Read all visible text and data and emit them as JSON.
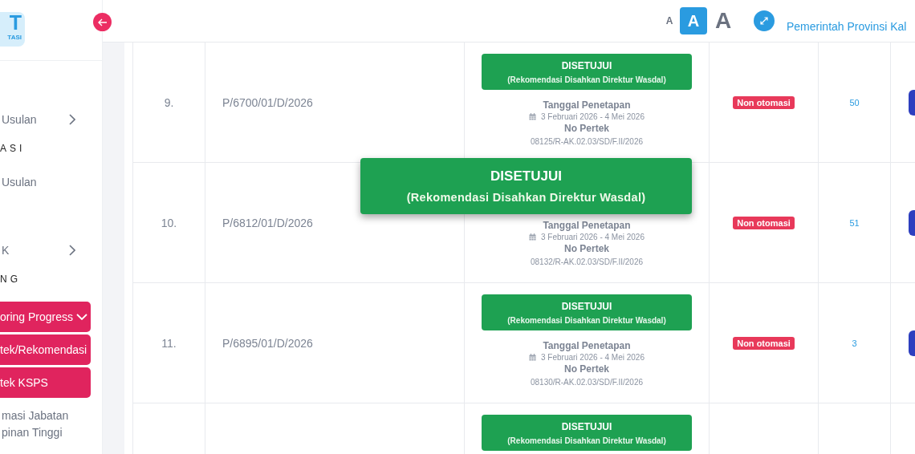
{
  "sidebar": {
    "logo": {
      "mark": "T",
      "caption": "TASI"
    },
    "items": [
      {
        "kind": "submenu",
        "label": "Usulan"
      },
      {
        "kind": "section",
        "label": "ASI"
      },
      {
        "kind": "link",
        "label": "Usulan"
      },
      {
        "kind": "submenu",
        "label": "K"
      },
      {
        "kind": "section",
        "label": "NG"
      },
      {
        "kind": "dropdown",
        "label": "oring Progress"
      },
      {
        "kind": "pill",
        "label": "tek/Rekomendasi"
      },
      {
        "kind": "pill",
        "label": "tek KSPS"
      },
      {
        "kind": "link",
        "label": "masi Jabatan"
      },
      {
        "kind": "link",
        "label": "pinan Tinggi"
      }
    ]
  },
  "header": {
    "font_sizes": [
      {
        "label": "A",
        "selected": false
      },
      {
        "label": "A",
        "selected": true
      },
      {
        "label": "A",
        "selected": false
      }
    ],
    "organization": "Pemerintah Provinsi Kal"
  },
  "table": {
    "rows": [
      {
        "number": "9.",
        "code": "P/6700/01/D/2026",
        "status": {
          "title": "DISETUJUI",
          "subtitle": "(Rekomendasi Disahkan Direktur Wasdal)"
        },
        "date_label": "Tanggal Penetapan",
        "date_range": "3 Februari 2026 - 4 Mei 2026",
        "pertek_label": "No Pertek",
        "pertek_number": "08125/R-AK.02.03/SD/F.II/2026",
        "type": "Non otomasi",
        "count": "50"
      },
      {
        "number": "10.",
        "code": "P/6812/01/D/2026",
        "date_label": "Tanggal Penetapan",
        "date_range": "3 Februari 2026 - 4 Mei 2026",
        "pertek_label": "No Pertek",
        "pertek_number": "08132/R-AK.02.03/SD/F.II/2026",
        "type": "Non otomasi",
        "count": "51"
      },
      {
        "number": "11.",
        "code": "P/6895/01/D/2026",
        "status": {
          "title": "DISETUJUI",
          "subtitle": "(Rekomendasi Disahkan Direktur Wasdal)"
        },
        "date_label": "Tanggal Penetapan",
        "date_range": "3 Februari 2026 - 4 Mei 2026",
        "pertek_label": "No Pertek",
        "pertek_number": "08130/R-AK.02.03/SD/F.II/2026",
        "type": "Non otomasi",
        "count": "3"
      },
      {
        "status": {
          "title": "DISETUJUI",
          "subtitle": "(Rekomendasi Disahkan Direktur Wasdal)"
        }
      }
    ]
  },
  "tooltip": {
    "title": "DISETUJUI",
    "subtitle": "(Rekomendasi Disahkan Direktur Wasdal)"
  }
}
